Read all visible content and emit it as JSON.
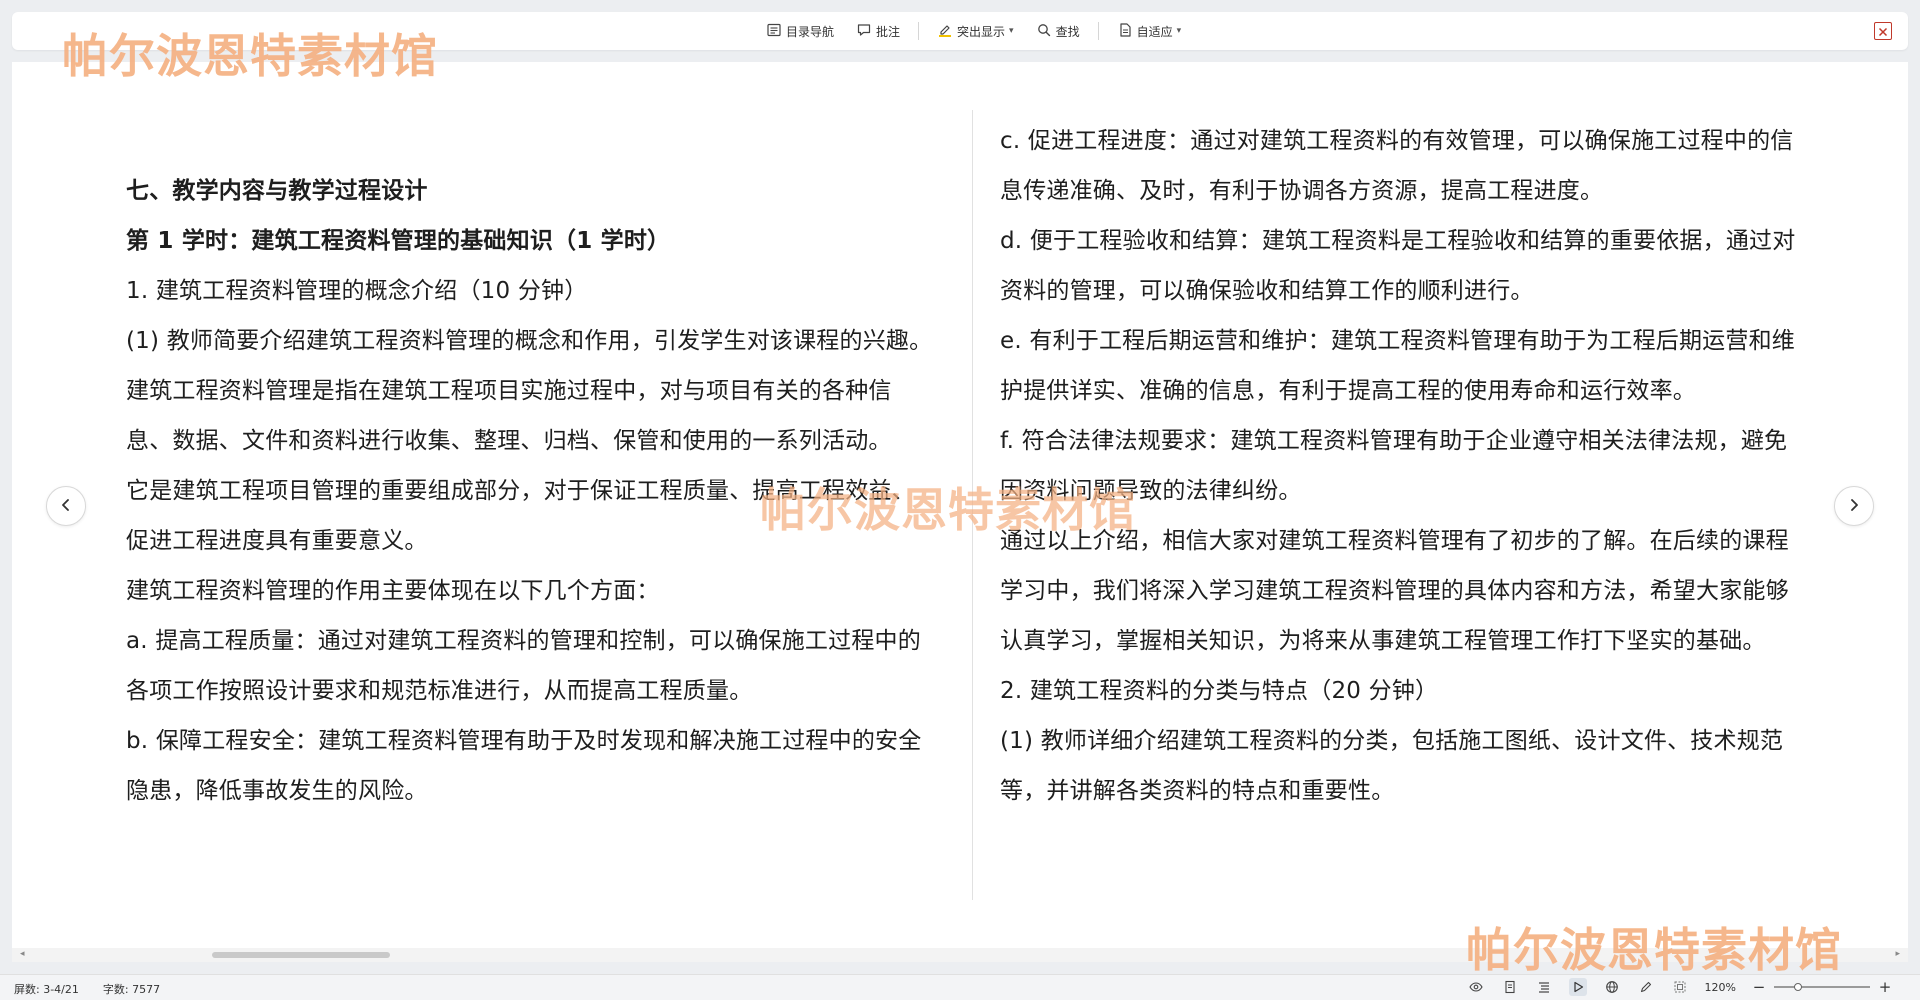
{
  "toolbar": {
    "items": [
      {
        "label": "目录导航",
        "icon": "outline-list-icon"
      },
      {
        "label": "批注",
        "icon": "comment-icon"
      },
      {
        "label": "突出显示",
        "icon": "highlighter-icon",
        "dropdown": true
      },
      {
        "label": "查找",
        "icon": "search-icon"
      },
      {
        "label": "自适应",
        "icon": "page-fit-icon",
        "dropdown": true
      }
    ],
    "close_icon": "close-icon"
  },
  "document": {
    "left_column": [
      {
        "text": "七、教学内容与教学过程设计",
        "bold": true
      },
      {
        "text": "第 1 学时：建筑工程资料管理的基础知识（1 学时）",
        "bold": true
      },
      {
        "text": "1. 建筑工程资料管理的概念介绍（10 分钟）",
        "bold": false
      },
      {
        "text": "(1) 教师简要介绍建筑工程资料管理的概念和作用，引发学生对该课程的兴趣。",
        "bold": false
      },
      {
        "text": "建筑工程资料管理是指在建筑工程项目实施过程中，对与项目有关的各种信息、数据、文件和资料进行收集、整理、归档、保管和使用的一系列活动。",
        "bold": false
      },
      {
        "text": "它是建筑工程项目管理的重要组成部分，对于保证工程质量、提高工程效益、促进工程进度具有重要意义。",
        "bold": false
      },
      {
        "text": "建筑工程资料管理的作用主要体现在以下几个方面：",
        "bold": false
      },
      {
        "text": "a. 提高工程质量：通过对建筑工程资料的管理和控制，可以确保施工过程中的各项工作按照设计要求和规范标准进行，从而提高工程质量。",
        "bold": false
      },
      {
        "text": "b. 保障工程安全：建筑工程资料管理有助于及时发现和解决施工过程中的安全隐患，降低事故发生的风险。",
        "bold": false
      }
    ],
    "right_column": [
      {
        "text": "c. 促进工程进度：通过对建筑工程资料的有效管理，可以确保施工过程中的信息传递准确、及时，有利于协调各方资源，提高工程进度。",
        "bold": false
      },
      {
        "text": "d. 便于工程验收和结算：建筑工程资料是工程验收和结算的重要依据，通过对资料的管理，可以确保验收和结算工作的顺利进行。",
        "bold": false
      },
      {
        "text": "e. 有利于工程后期运营和维护：建筑工程资料管理有助于为工程后期运营和维护提供详实、准确的信息，有利于提高工程的使用寿命和运行效率。",
        "bold": false
      },
      {
        "text": "f. 符合法律法规要求：建筑工程资料管理有助于企业遵守相关法律法规，避免因资料问题导致的法律纠纷。",
        "bold": false
      },
      {
        "text": "通过以上介绍，相信大家对建筑工程资料管理有了初步的了解。在后续的课程学习中，我们将深入学习建筑工程资料管理的具体内容和方法，希望大家能够认真学习，掌握相关知识，为将来从事建筑工程管理工作打下坚实的基础。",
        "bold": false
      },
      {
        "text": "2. 建筑工程资料的分类与特点（20 分钟）",
        "bold": false
      },
      {
        "text": "(1) 教师详细介绍建筑工程资料的分类，包括施工图纸、设计文件、技术规范等，并讲解各类资料的特点和重要性。",
        "bold": false
      }
    ]
  },
  "watermarks": [
    "帕尔波恩特素材馆",
    "帕尔波恩特素材馆",
    "帕尔波恩特素材馆"
  ],
  "statusbar": {
    "page_info": "屏数: 3-4/21",
    "word_count": "字数: 7577",
    "icons": [
      "eye-icon",
      "page-view-icon",
      "outline-view-icon",
      "play-icon",
      "web-icon",
      "pen-icon",
      "fit-screen-icon"
    ],
    "zoom": "120%",
    "zoom_minus": "−",
    "zoom_plus": "+",
    "zoom_level": 0.25
  },
  "colors": {
    "watermark": "#f5b183",
    "close": "#c0392b",
    "background": "#eceef1"
  }
}
